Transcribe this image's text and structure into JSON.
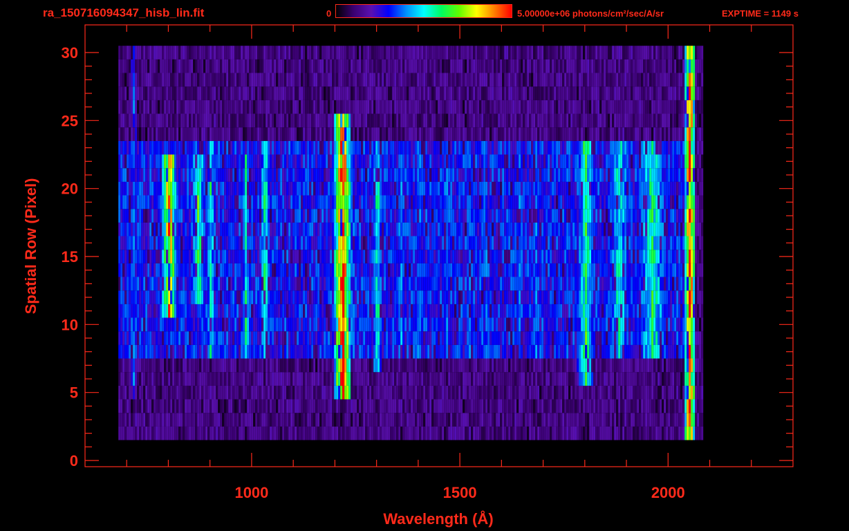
{
  "header": {
    "file_title": "ra_150716094347_hisb_lin.fit",
    "colorbar_min": "0",
    "colorbar_max": "5.00000e+06 photons/cm²/sec/A/sr",
    "exptime": "EXPTIME = 1149 s"
  },
  "colors": {
    "axis": "#ff2a1a",
    "background": "#000000",
    "colormap": [
      "#000000",
      "#3a0070",
      "#5a10b0",
      "#0000ff",
      "#0090ff",
      "#00ffff",
      "#00ff60",
      "#60ff00",
      "#ffff00",
      "#ff8000",
      "#ff0000"
    ]
  },
  "chart_data": {
    "type": "heatmap",
    "title": "ra_150716094347_hisb_lin.fit",
    "xlabel": "Wavelength (Å)",
    "ylabel": "Spatial Row (Pixel)",
    "xlim": [
      600,
      2300
    ],
    "ylim": [
      0,
      30
    ],
    "x_ticks": [
      1000,
      1500,
      2000
    ],
    "y_ticks": [
      0,
      5,
      10,
      15,
      20,
      25,
      30
    ],
    "x_tick_labels": [
      "1000",
      "1500",
      "2000"
    ],
    "y_tick_labels": [
      "0",
      "5",
      "10",
      "15",
      "20",
      "25",
      "30"
    ],
    "x_minor_step": 100,
    "y_minor_step": 1,
    "colorbar": {
      "min": 0,
      "max": 5000000,
      "units": "photons/cm²/sec/A/sr"
    },
    "intensity_scale": "normalized 0-1 of colorbar max",
    "data_extent": {
      "wavelength": [
        780,
        2060
      ],
      "rows": [
        2,
        30
      ]
    },
    "background_level": 0.14,
    "bright_region": {
      "wavelength": [
        680,
        2060
      ],
      "rows": [
        8,
        23
      ],
      "level": 0.3
    },
    "features": [
      {
        "name": "edge line",
        "wavelength": 715,
        "rows": [
          5,
          30
        ],
        "level": 0.35,
        "width": 8
      },
      {
        "name": "ring left arc",
        "wavelength": 800,
        "rows": [
          11,
          22
        ],
        "level": 0.85,
        "width": 18
      },
      {
        "name": "ring right arc",
        "wavelength": 870,
        "rows": [
          12,
          22
        ],
        "level": 0.6,
        "width": 16
      },
      {
        "name": "emission line",
        "wavelength": 900,
        "rows": [
          8,
          23
        ],
        "level": 0.55,
        "width": 10
      },
      {
        "name": "emission line",
        "wavelength": 985,
        "rows": [
          8,
          23
        ],
        "level": 0.55,
        "width": 10
      },
      {
        "name": "emission line",
        "wavelength": 1030,
        "rows": [
          8,
          23
        ],
        "level": 0.55,
        "width": 12
      },
      {
        "name": "Lyman-alpha",
        "wavelength": 1216,
        "rows": [
          5,
          25
        ],
        "level": 0.97,
        "width": 20
      },
      {
        "name": "emission line",
        "wavelength": 1240,
        "rows": [
          8,
          23
        ],
        "level": 0.4,
        "width": 10
      },
      {
        "name": "emission line",
        "wavelength": 1300,
        "rows": [
          7,
          23
        ],
        "level": 0.55,
        "width": 12
      },
      {
        "name": "emission line",
        "wavelength": 1356,
        "rows": [
          8,
          23
        ],
        "level": 0.42,
        "width": 10
      },
      {
        "name": "emission line",
        "wavelength": 1400,
        "rows": [
          8,
          23
        ],
        "level": 0.4,
        "width": 10
      },
      {
        "name": "emission line",
        "wavelength": 1465,
        "rows": [
          8,
          23
        ],
        "level": 0.4,
        "width": 10
      },
      {
        "name": "emission line",
        "wavelength": 1520,
        "rows": [
          8,
          23
        ],
        "level": 0.38,
        "width": 10
      },
      {
        "name": "emission line",
        "wavelength": 1560,
        "rows": [
          8,
          23
        ],
        "level": 0.38,
        "width": 10
      },
      {
        "name": "emission line",
        "wavelength": 1640,
        "rows": [
          8,
          23
        ],
        "level": 0.38,
        "width": 10
      },
      {
        "name": "emission line",
        "wavelength": 1680,
        "rows": [
          8,
          23
        ],
        "level": 0.38,
        "width": 10
      },
      {
        "name": "band",
        "wavelength": 1800,
        "rows": [
          6,
          23
        ],
        "level": 0.6,
        "width": 20
      },
      {
        "name": "band",
        "wavelength": 1880,
        "rows": [
          8,
          23
        ],
        "level": 0.5,
        "width": 30
      },
      {
        "name": "band",
        "wavelength": 1960,
        "rows": [
          8,
          23
        ],
        "level": 0.55,
        "width": 40
      },
      {
        "name": "edge",
        "wavelength": 2050,
        "rows": [
          2,
          30
        ],
        "level": 0.92,
        "width": 14
      }
    ]
  }
}
